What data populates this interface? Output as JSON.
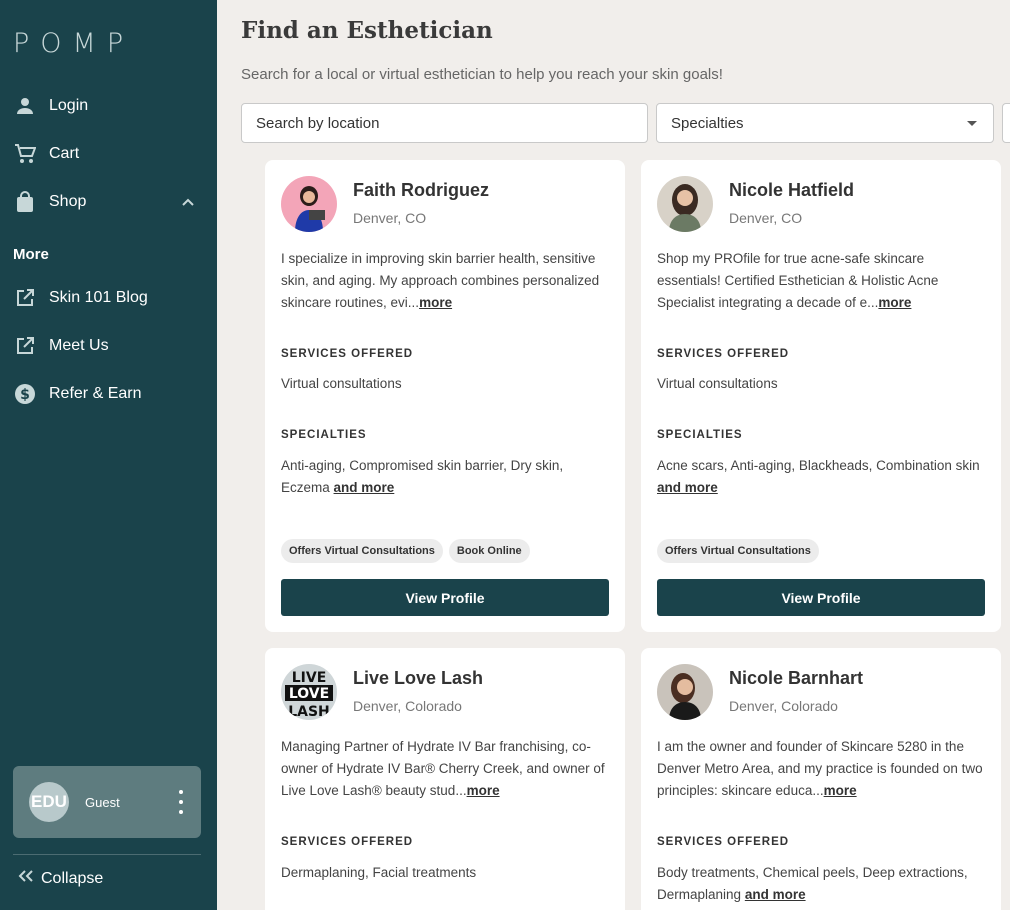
{
  "sidebar": {
    "logo": "POMP",
    "items": [
      {
        "label": "Login",
        "icon": "person-icon"
      },
      {
        "label": "Cart",
        "icon": "cart-icon"
      },
      {
        "label": "Shop",
        "icon": "bag-icon"
      }
    ],
    "more_heading": "More",
    "more_items": [
      {
        "label": "Skin 101 Blog",
        "icon": "external-link-icon"
      },
      {
        "label": "Meet Us",
        "icon": "external-link-icon"
      },
      {
        "label": "Refer & Earn",
        "icon": "dollar-icon"
      }
    ],
    "user": {
      "avatar_text": "EDU",
      "name": "Guest"
    },
    "collapse_label": "Collapse"
  },
  "main": {
    "title": "Find an Esthetician",
    "subtitle": "Search for a local or virtual esthetician to help you reach your skin goals!",
    "search_placeholder": "Search by location",
    "specialties_label": "Specialties"
  },
  "labels": {
    "services": "SERVICES OFFERED",
    "specialties": "SPECIALTIES",
    "more": "more",
    "and_more": "and more",
    "view_profile": "View Profile"
  },
  "cards": [
    {
      "name": "Faith Rodriguez",
      "location": "Denver, CO",
      "bio": "I specialize in improving skin barrier health, sensitive skin, and aging. My approach combines personalized skincare routines, evi...",
      "services": "Virtual consultations",
      "specialties": "Anti-aging, Compromised skin barrier, Dry skin, Eczema",
      "badges": [
        "Offers Virtual Consultations",
        "Book Online"
      ]
    },
    {
      "name": "Nicole Hatfield",
      "location": "Denver, CO",
      "bio": "Shop my PROfile for true acne-safe skincare essentials! Certified Esthetician & Holistic Acne Specialist integrating a decade of e...",
      "services": "Virtual consultations",
      "specialties": "Acne scars, Anti-aging, Blackheads, Combination skin",
      "badges": [
        "Offers Virtual Consultations"
      ]
    },
    {
      "name": "Live Love Lash",
      "location": "Denver, Colorado",
      "bio": "Managing Partner of Hydrate IV Bar franchising, co-owner of Hydrate IV Bar® Cherry Creek, and owner of Live Love Lash® beauty stud...",
      "services": "Dermaplaning, Facial treatments",
      "logo_text": "LIVE LOVE LASH"
    },
    {
      "name": "Nicole Barnhart",
      "location": "Denver, Colorado",
      "bio": "I am the owner and founder of Skincare 5280 in the Denver Metro Area, and my practice is founded on two principles: skincare educa...",
      "services": "Body treatments, Chemical peels, Deep extractions, Dermaplaning"
    }
  ]
}
